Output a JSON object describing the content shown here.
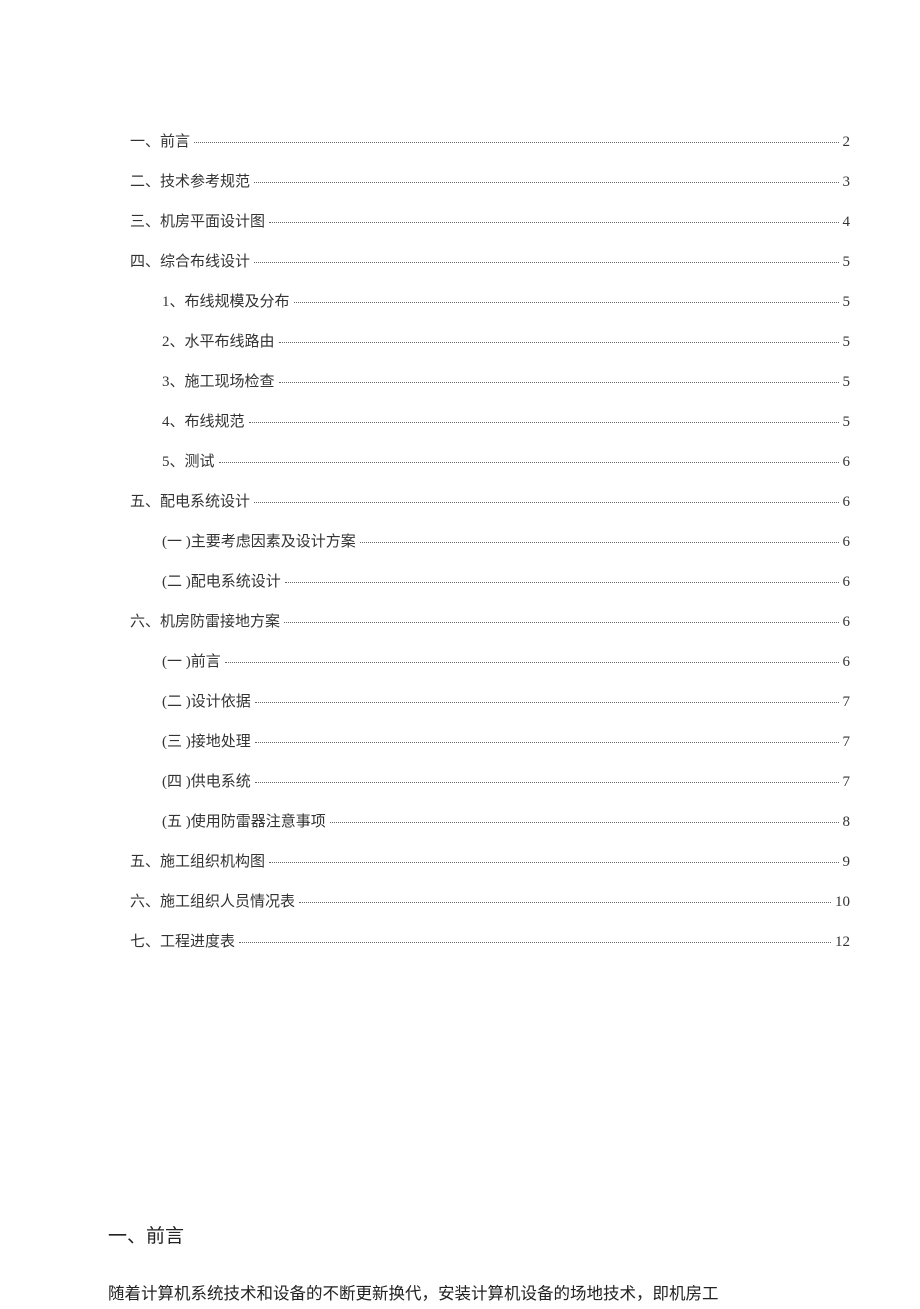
{
  "toc": [
    {
      "label": "一、前言",
      "page": "2",
      "sub": false
    },
    {
      "label": "二、技术参考规范",
      "page": "3",
      "sub": false
    },
    {
      "label": "三、机房平面设计图",
      "page": "4",
      "sub": false
    },
    {
      "label": "四、综合布线设计",
      "page": "5",
      "sub": false
    },
    {
      "label": "1、布线规模及分布",
      "page": "5",
      "sub": true
    },
    {
      "label": "2、水平布线路由",
      "page": "5",
      "sub": true
    },
    {
      "label": "3、施工现场检查",
      "page": "5",
      "sub": true
    },
    {
      "label": "4、布线规范",
      "page": "5",
      "sub": true
    },
    {
      "label": "5、测试",
      "page": "6",
      "sub": true
    },
    {
      "label": "五、配电系统设计",
      "page": "6",
      "sub": false
    },
    {
      "label": "(一 )主要考虑因素及设计方案",
      "page": "6",
      "sub": true
    },
    {
      "label": "(二 )配电系统设计",
      "page": "6",
      "sub": true
    },
    {
      "label": "六、机房防雷接地方案",
      "page": "6",
      "sub": false
    },
    {
      "label": "(一 )前言",
      "page": "6",
      "sub": true
    },
    {
      "label": "(二 )设计依据",
      "page": "7",
      "sub": true
    },
    {
      "label": "(三 )接地处理",
      "page": "7",
      "sub": true
    },
    {
      "label": "(四 )供电系统",
      "page": "7",
      "sub": true
    },
    {
      "label": "(五 )使用防雷器注意事项",
      "page": "8",
      "sub": true
    },
    {
      "label": "五、施工组织机构图",
      "page": "9",
      "sub": false
    },
    {
      "label": "六、施工组织人员情况表",
      "page": "10",
      "sub": false
    },
    {
      "label": "七、工程进度表",
      "page": "12",
      "sub": false
    }
  ],
  "heading": "一、前言",
  "body": "随着计算机系统技术和设备的不断更新换代，安装计算机设备的场地技术，即机房工"
}
